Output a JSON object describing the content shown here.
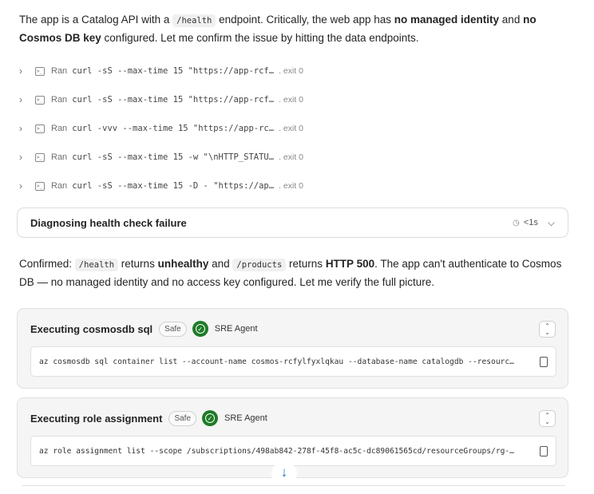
{
  "intro": {
    "p1": "The app is a Catalog API with a ",
    "code1": "/health",
    "p2": " endpoint. Critically, the web app has ",
    "b1": "no managed identity",
    "p3": " and ",
    "b2": "no Cosmos DB key",
    "p4": " configured. Let me confirm the issue by hitting the data endpoints."
  },
  "runs": [
    {
      "label": "Ran",
      "cmd": "curl -sS --max-time 15 \"https://app-rcf…",
      "status": ". exit 0"
    },
    {
      "label": "Ran",
      "cmd": "curl -sS --max-time 15 \"https://app-rcf…",
      "status": ". exit 0"
    },
    {
      "label": "Ran",
      "cmd": "curl -vvv --max-time 15 \"https://app-rc…",
      "status": ". exit 0"
    },
    {
      "label": "Ran",
      "cmd": "curl -sS --max-time 15 -w \"\\nHTTP_STATU…",
      "status": ". exit 0"
    },
    {
      "label": "Ran",
      "cmd": "curl -sS --max-time 15 -D - \"https://ap…",
      "status": ". exit 0"
    }
  ],
  "diagnosis": {
    "title": "Diagnosing health check failure",
    "time": "<1s"
  },
  "confirm": {
    "p1": "Confirmed: ",
    "code1": "/health",
    "p2": " returns ",
    "b1": "unhealthy",
    "p3": " and ",
    "code2": "/products",
    "p4": " returns ",
    "b2": "HTTP 500",
    "p5": ". The app can't authenticate to Cosmos DB — no managed identity and no access key configured. Let me verify the full picture."
  },
  "cards": [
    {
      "title": "Executing cosmosdb sql",
      "badge": "Safe",
      "agent": "SRE Agent",
      "command": "az cosmosdb sql container list --account-name cosmos-rcfylfyxlqkau --database-name catalogdb --resourc…"
    },
    {
      "title": "Executing role assignment",
      "badge": "Safe",
      "agent": "SRE Agent",
      "command": "az role assignment list --scope /subscriptions/498ab842-278f-45f8-ac5c-dc89061565cd/resourceGroups/rg-…"
    }
  ],
  "colors": {
    "success": "#1e7b28",
    "accent": "#2a6fc9"
  }
}
